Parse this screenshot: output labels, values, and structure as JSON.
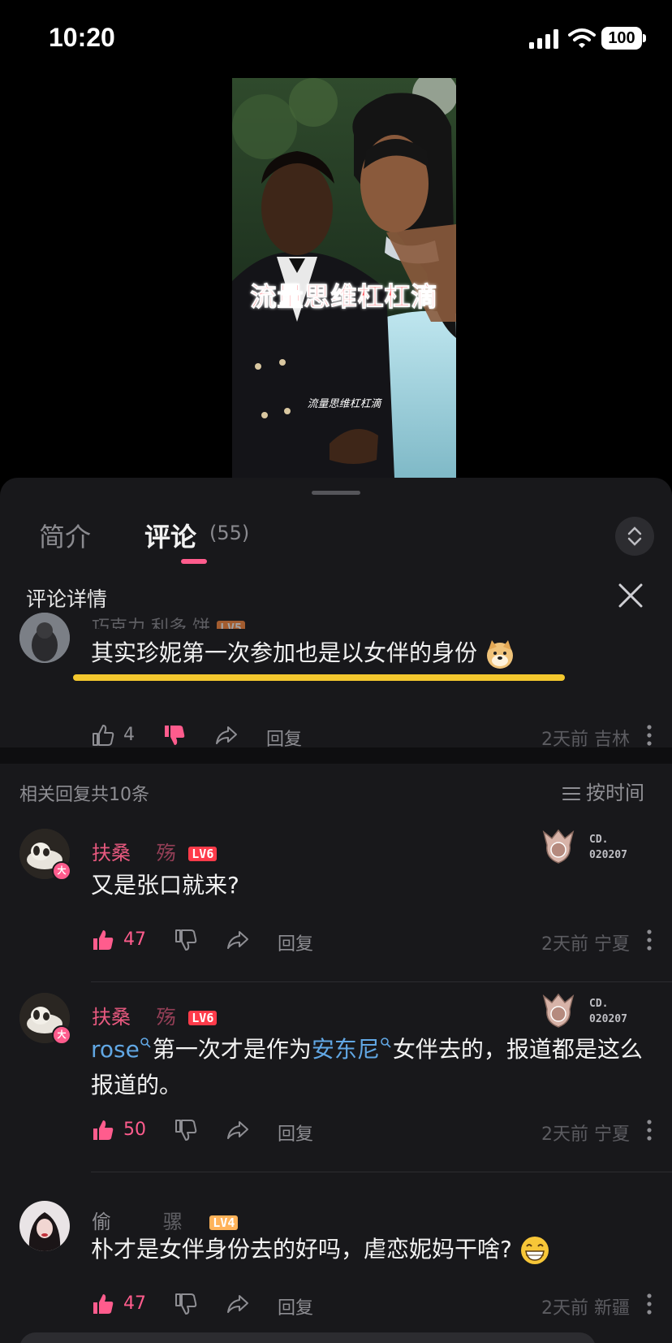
{
  "status_bar": {
    "time": "10:20",
    "battery": "100"
  },
  "video": {
    "overlay_title": "流量思维杠杠滴",
    "subtitle": "流量思维杠杠滴"
  },
  "tabs": {
    "intro": "简介",
    "comments": "评论",
    "comments_count": "(55)"
  },
  "detail": {
    "title": "评论详情"
  },
  "main_comment": {
    "username": "巧克力 利多 饼",
    "level": "LV5",
    "text": "其实珍妮第一次参加也是以女伴的身份",
    "likes": "4",
    "reply_label": "回复",
    "time": "2天前",
    "location": "吉林"
  },
  "related": {
    "header": "相关回复共10条",
    "sort_label": "按时间"
  },
  "replies": [
    {
      "username": "扶桑",
      "username_suffix": "殇",
      "level": "LV6",
      "badge": "大",
      "medal_line1": "CD.",
      "medal_line2": "020207",
      "text": "又是张口就来?",
      "likes": "47",
      "reply_label": "回复",
      "time": "2天前",
      "location": "宁夏"
    },
    {
      "username": "扶桑",
      "username_suffix": "殇",
      "level": "LV6",
      "badge": "大",
      "medal_line1": "CD.",
      "medal_line2": "020207",
      "mention1": "rose",
      "text_part1": "第一次才是作为",
      "mention2": "安东尼",
      "text_part2": "女伴去的，报道都是这么报道的。",
      "likes": "50",
      "reply_label": "回复",
      "time": "2天前",
      "location": "宁夏"
    },
    {
      "username": "偷",
      "username_suffix": "骡",
      "level": "LV4",
      "text": "朴才是女伴身份去的好吗，虐恋妮妈干啥?",
      "likes": "47",
      "reply_label": "回复",
      "time": "2天前",
      "location": "新疆"
    }
  ],
  "colors": {
    "accent": "#ff5c8d",
    "mention": "#61a7e4",
    "highlight": "#f4c82e",
    "background": "#18181b"
  }
}
